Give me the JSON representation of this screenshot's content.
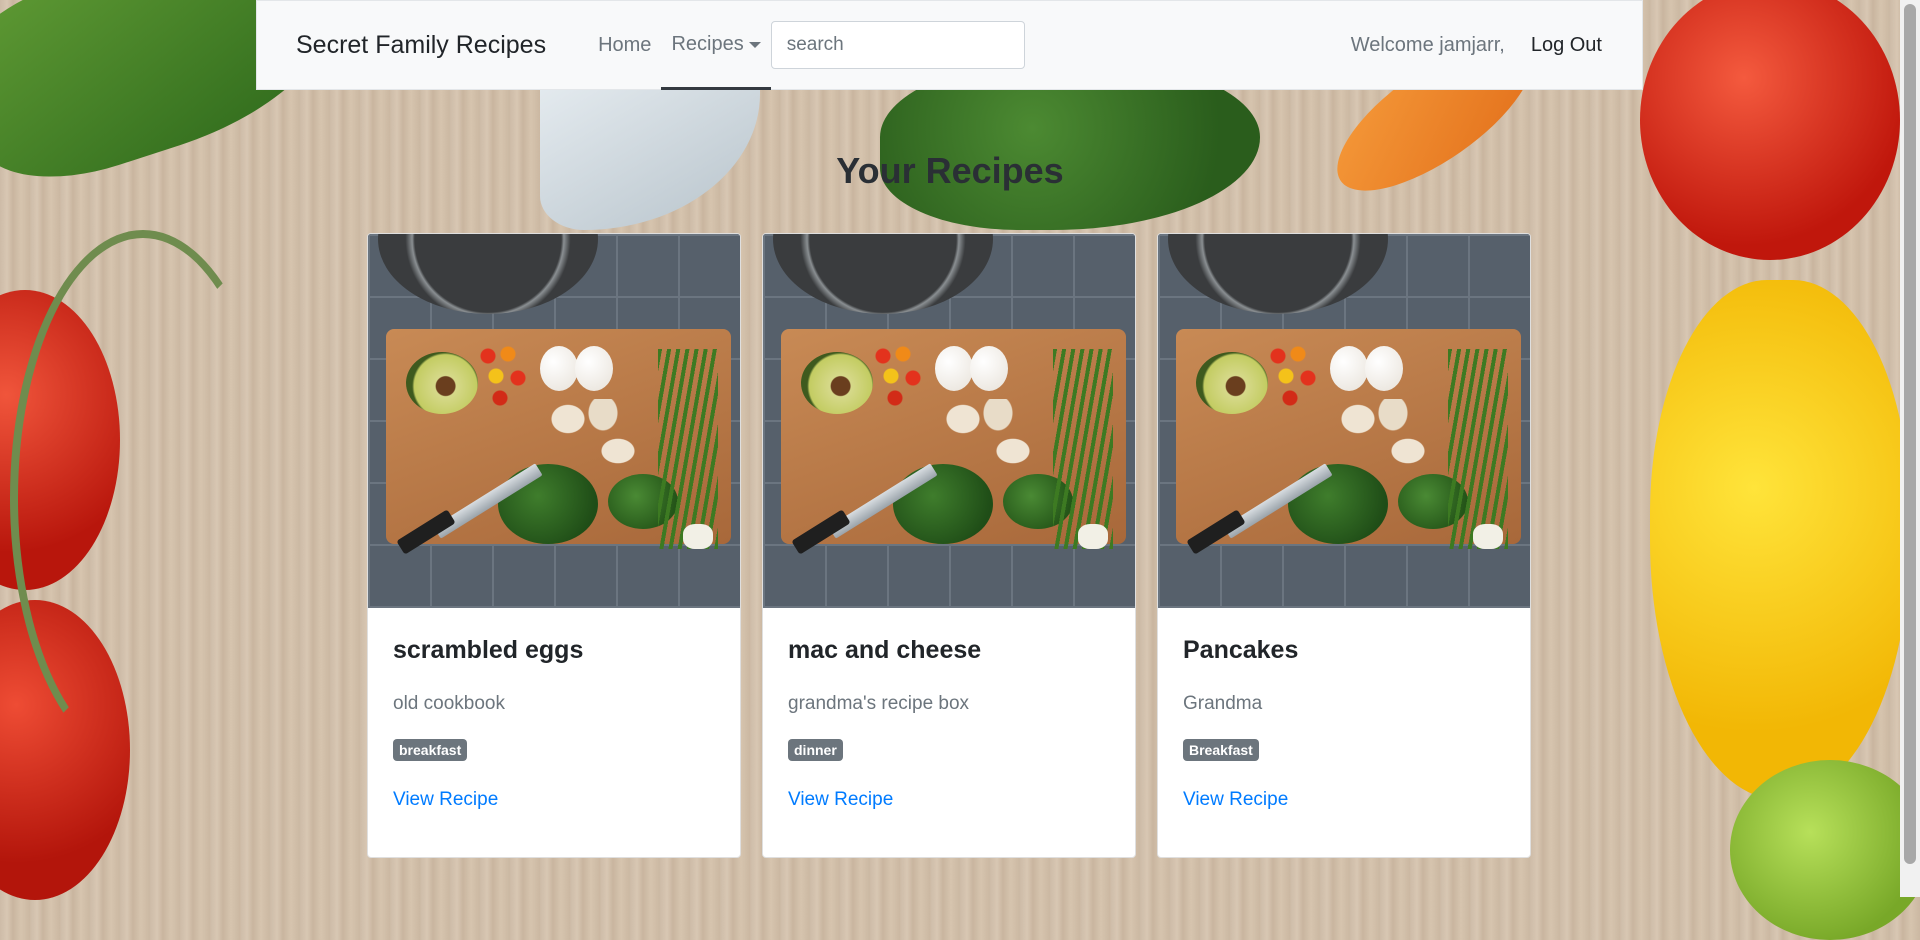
{
  "navbar": {
    "brand": "Secret Family Recipes",
    "home_label": "Home",
    "recipes_label": "Recipes",
    "search_placeholder": "search",
    "welcome_text": "Welcome jamjarr,",
    "logout_label": "Log Out"
  },
  "main": {
    "title": "Your Recipes",
    "cards": [
      {
        "title": "scrambled eggs",
        "source": "old cookbook",
        "category": "breakfast",
        "link_label": "View Recipe"
      },
      {
        "title": "mac and cheese",
        "source": "grandma's recipe box",
        "category": "dinner",
        "link_label": "View Recipe"
      },
      {
        "title": "Pancakes",
        "source": "Grandma",
        "category": "Breakfast",
        "link_label": "View Recipe"
      }
    ]
  },
  "colors": {
    "navbar_bg": "#f8f9fa",
    "link": "#007bff",
    "badge": "#6c757d",
    "muted_text": "#6c757d"
  },
  "icons": {
    "dropdown": "caret-down-icon"
  }
}
